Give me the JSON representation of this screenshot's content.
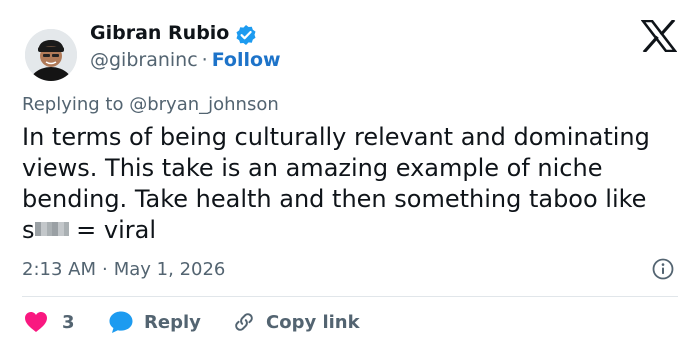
{
  "author": {
    "name": "Gibran Rubio",
    "handle": "@gibraninc",
    "separator": "·",
    "follow_label": "Follow",
    "avatar_icon": "avatar-icon",
    "verified_icon": "verified-badge-icon"
  },
  "brand": {
    "logo_icon": "x-logo-icon"
  },
  "reply_context": {
    "prefix": "Replying to",
    "mention": "@bryan_johnson"
  },
  "tweet": {
    "text_before_redaction": "In terms of being culturally relevant and dominating views. This take is an amazing example of niche bending. Take health and then something taboo like s",
    "text_after_redaction": " = viral"
  },
  "meta": {
    "time": "2:13 AM",
    "separator": "·",
    "date": "May 1, 2026",
    "info_icon": "info-icon"
  },
  "actions": {
    "like_count": "3",
    "reply_label": "Reply",
    "copy_label": "Copy link"
  },
  "colors": {
    "like": "#f91880",
    "reply": "#1d9bf0",
    "follow": "#1d73c9",
    "muted": "#536471",
    "text": "#0f1419",
    "verified": "#1d9bf0"
  }
}
